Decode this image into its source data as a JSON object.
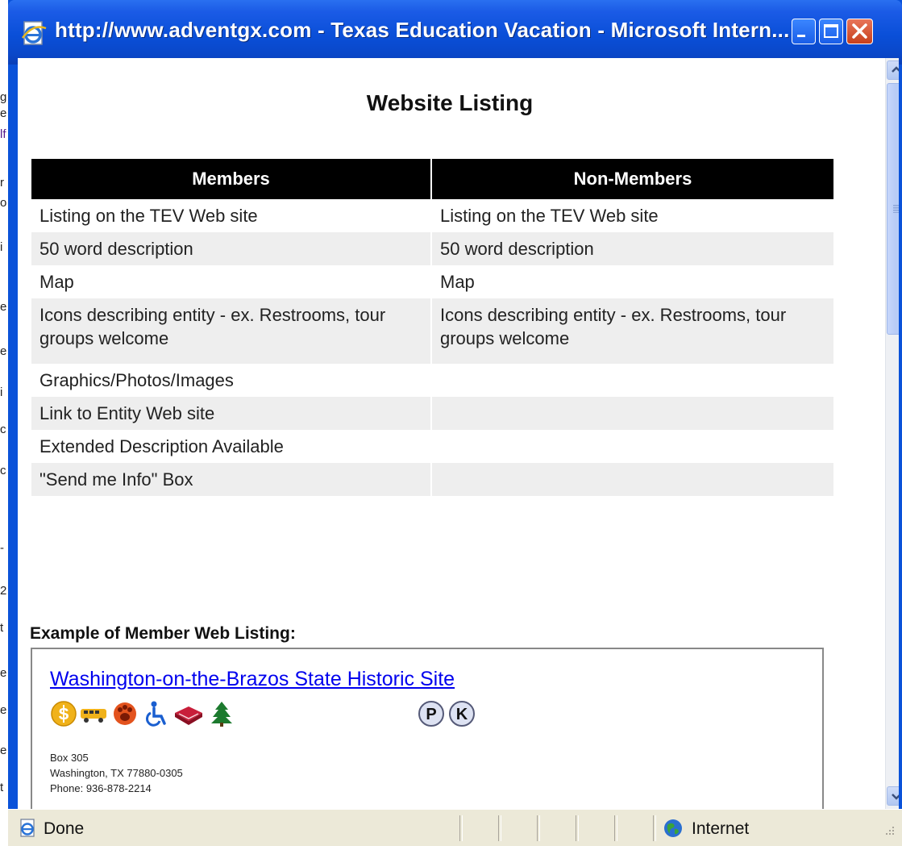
{
  "window": {
    "title": "http://www.adventgx.com - Texas Education Vacation - Microsoft Intern...",
    "controls": [
      "minimize",
      "maximize",
      "close"
    ]
  },
  "page": {
    "heading": "Website Listing",
    "table": {
      "headers": [
        "Members",
        "Non-Members"
      ],
      "rows": [
        {
          "members": "Listing on the TEV Web site",
          "non_members": "Listing on the TEV Web site"
        },
        {
          "members": "50 word description",
          "non_members": "50 word description"
        },
        {
          "members": "Map",
          "non_members": "Map"
        },
        {
          "members": "Icons describing entity - ex. Restrooms, tour groups welcome",
          "non_members": "Icons describing entity - ex. Restrooms, tour groups welcome"
        },
        {
          "members": "Graphics/Photos/Images",
          "non_members": ""
        },
        {
          "members": "Link to Entity Web site",
          "non_members": ""
        },
        {
          "members": "Extended Description Available",
          "non_members": ""
        },
        {
          "members": "\"Send me Info\" Box",
          "non_members": ""
        }
      ]
    },
    "example_label": "Example of Member Web Listing:",
    "example": {
      "link": "Washington-on-the-Brazos State Historic Site",
      "icons": [
        "dollar-icon",
        "bus-icon",
        "paw-icon",
        "wheelchair-icon",
        "book-icon",
        "tree-icon"
      ],
      "badges": [
        {
          "label": "P"
        },
        {
          "label": "K"
        }
      ],
      "address_lines": [
        "Box 305",
        "Washington, TX  77880-0305",
        "Phone: 936-878-2214"
      ]
    }
  },
  "status": {
    "text": "Done",
    "zone": "Internet"
  },
  "colors": {
    "titlebar": "#0a4fd8",
    "table_header_bg": "#000000",
    "row_alt_bg": "#eeeeee",
    "link": "#0000ee",
    "statusbar": "#ece9d8"
  }
}
